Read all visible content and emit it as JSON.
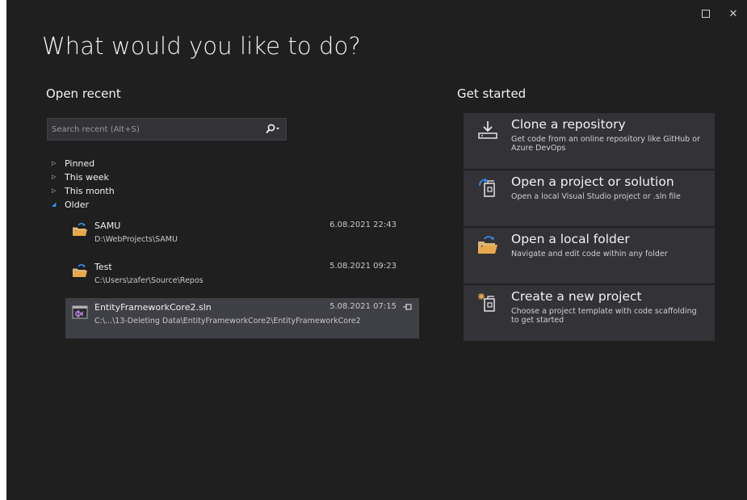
{
  "window": {
    "controls": {
      "maximize_label": "",
      "close_label": "✕"
    }
  },
  "header": {
    "title": "What would you like to do?"
  },
  "open_recent": {
    "title": "Open recent",
    "search": {
      "placeholder": "Search recent (Alt+S)",
      "value": ""
    },
    "groups": [
      {
        "label": "Pinned",
        "expanded": false
      },
      {
        "label": "This week",
        "expanded": false
      },
      {
        "label": "This month",
        "expanded": false
      },
      {
        "label": "Older",
        "expanded": true
      }
    ],
    "items": [
      {
        "name": "SAMU",
        "path": "D:\\WebProjects\\SAMU",
        "date": "6.08.2021 22:43",
        "icon": "folder-icon"
      },
      {
        "name": "Test",
        "path": "C:\\Users\\zafer\\Source\\Repos",
        "date": "5.08.2021 09:23",
        "icon": "folder-icon"
      },
      {
        "name": "EntityFrameworkCore2.sln",
        "path": "C:\\...\\13-Deleting Data\\EntityFrameworkCore2\\EntityFrameworkCore2",
        "date": "5.08.2021 07:15",
        "icon": "solution-icon"
      }
    ]
  },
  "get_started": {
    "title": "Get started",
    "cards": [
      {
        "title": "Clone a repository",
        "description": "Get code from an online repository like GitHub or Azure DevOps",
        "icon": "clone-icon"
      },
      {
        "title": "Open a project or solution",
        "description": "Open a local Visual Studio project or .sln file",
        "icon": "open-project-icon"
      },
      {
        "title": "Open a local folder",
        "description": "Navigate and edit code within any folder",
        "icon": "folder-icon"
      },
      {
        "title": "Create a new project",
        "description": "Choose a project template with code scaffolding to get started",
        "icon": "new-project-icon"
      }
    ]
  },
  "colors": {
    "background": "#1f1f1f",
    "card": "#333337",
    "selected": "#3f3f46",
    "accent": "#3794ff",
    "folder": "#e8a94c"
  }
}
